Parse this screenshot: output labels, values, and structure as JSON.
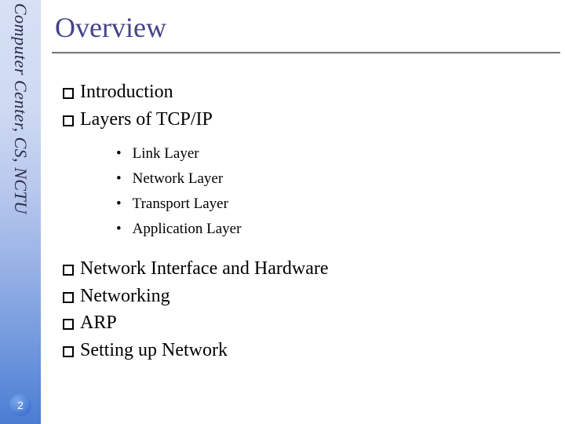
{
  "sidebar": {
    "label": "Computer Center, CS, NCTU",
    "page_number": "2"
  },
  "title": "Overview",
  "items_top": [
    {
      "label": "Introduction"
    },
    {
      "label": "Layers of TCP/IP"
    }
  ],
  "sub_items": [
    {
      "label": "Link Layer"
    },
    {
      "label": "Network Layer"
    },
    {
      "label": "Transport Layer"
    },
    {
      "label": "Application Layer"
    }
  ],
  "items_bottom": [
    {
      "label": "Network Interface and Hardware"
    },
    {
      "label": "Networking"
    },
    {
      "label": "ARP"
    },
    {
      "label": "Setting up Network"
    }
  ]
}
